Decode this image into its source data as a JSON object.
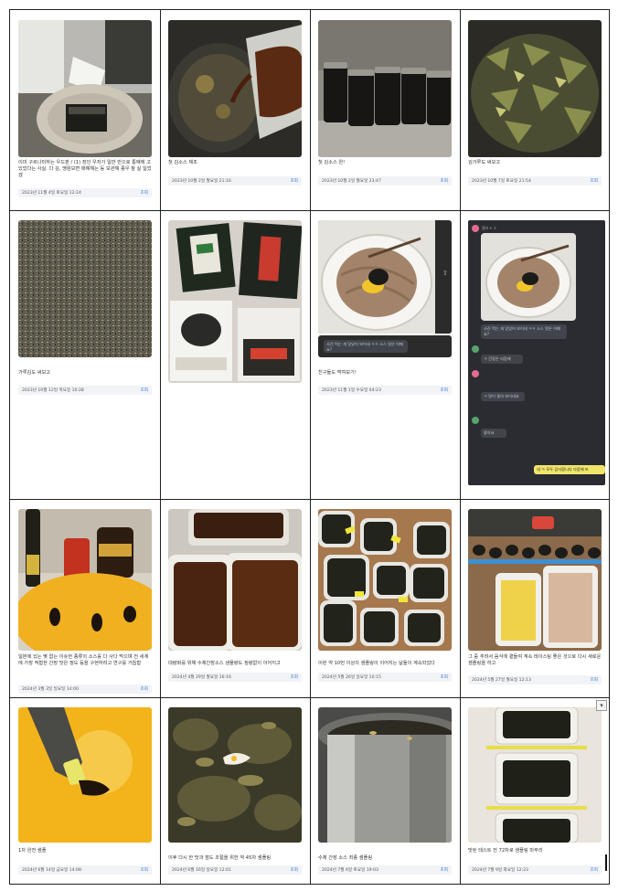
{
  "items": [
    {
      "caption": "이미 구르나미하는 우드판 / (1) 장인 우저가 일반 반으로 통째에 고 있었다는 사실. 다 김, 맹원보면 매해해는 등 보관해 종우 참 실 일었겠",
      "date": "2023년 11월 4일 토요일 12:24",
      "link": "조회"
    },
    {
      "caption": "첫 김소스 제조",
      "date": "2023년 10월 2일 월요일 21:16",
      "link": "조회"
    },
    {
      "caption": "첫 김소스 완!",
      "date": "2023년 10월 2일 월요일 23:47",
      "link": "조회"
    },
    {
      "caption": "김가루도 써보고",
      "date": "2023년 10월 7일 토요일 21:54",
      "link": "조회"
    },
    {
      "caption": "가루김도 써보고",
      "date": "2023년 10월 12일 목요일 10:28",
      "link": "조회"
    },
    {
      "caption": "",
      "date": "",
      "link": ""
    },
    {
      "caption": "친구들도 먹여보기!",
      "date": "2023년 11월 1일 수요일 04:23",
      "link": "조회"
    },
    {
      "caption": "",
      "date": "",
      "link": ""
    },
    {
      "caption": "일본에 있는 몇 없는 이슈한 종류의 소스를 다 사다 먹으며 전 세계에 가장 적합한 간장 맛은 정도 등을 구현하려고 연구를 거듭함",
      "date": "2024년 3월 3일 일요일 14:00",
      "link": "조회"
    },
    {
      "caption": "대량화를 위해 수제간장소스 생물량도 정량없이 이어지고",
      "date": "2024년 4월 29일 월요일 16:16",
      "link": "조회"
    },
    {
      "caption": "이런 약 10번 이상의 샘플링이 이어지는 날들이 계속되었다",
      "date": "2024년 5월 26일 일요일 10:15",
      "link": "조회"
    },
    {
      "caption": "그 중 추려서 음식에 곁들여 계속 테이스팅 좋은 것으로 다시 새로운 샘플링을 하고",
      "date": "2024년 5월 27일 월요일 12:13",
      "link": "조회"
    },
    {
      "caption": "1차 완전 샘플",
      "date": "2024년 6월 14일 금요일 14:08",
      "link": "조회"
    },
    {
      "caption": "이후 다시 한 맛과 점도 조절을 위한 약 45차 샘플링",
      "date": "2024년 6월 16일 일요일 12:01",
      "link": "조회"
    },
    {
      "caption": "수제 간장 소스 최종 샘플링",
      "date": "2024년 7월 6일 토요일 19:03",
      "link": "조회"
    },
    {
      "caption": "맛된 테스트 전 72차로 샘플링 마무리",
      "date": "2024년 7월 9일 화요일 12:23",
      "link": "조회"
    }
  ],
  "chat": {
    "sender": "멤버 ✦ 소",
    "messages": [
      "사진 먹는 게 맛있어 보이네 ㅋㅋ 소스 맛은 어때요?",
      "ㅋ 간장은 다음에",
      "ㅋ 맛이 좋아 보이네요",
      "좋아요"
    ],
    "my_message": "네 ㅋ 모두 감사합니다 다음에 또"
  }
}
